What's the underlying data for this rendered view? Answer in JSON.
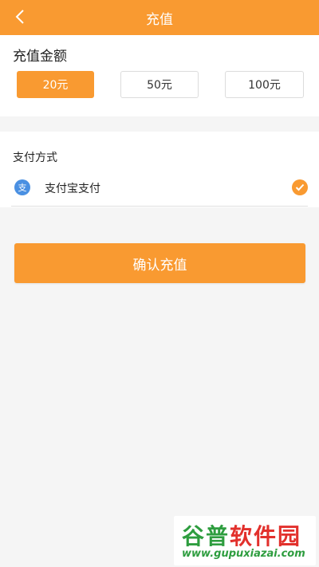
{
  "navbar": {
    "title": "充值",
    "back_icon": "chevron-left-icon",
    "color": "#f99a31"
  },
  "amount": {
    "title": "充值金额",
    "options": [
      "20元",
      "50元",
      "100元"
    ],
    "selected_index": 0
  },
  "payment": {
    "title": "支付方式",
    "method": {
      "icon_glyph": "支",
      "label": "支付宝支付",
      "selected": true
    }
  },
  "confirm_button": {
    "label": "确认充值"
  },
  "watermark": {
    "brand_part1": "谷普",
    "brand_part2": "软件园",
    "url": "www.gupuxiazai.com"
  }
}
